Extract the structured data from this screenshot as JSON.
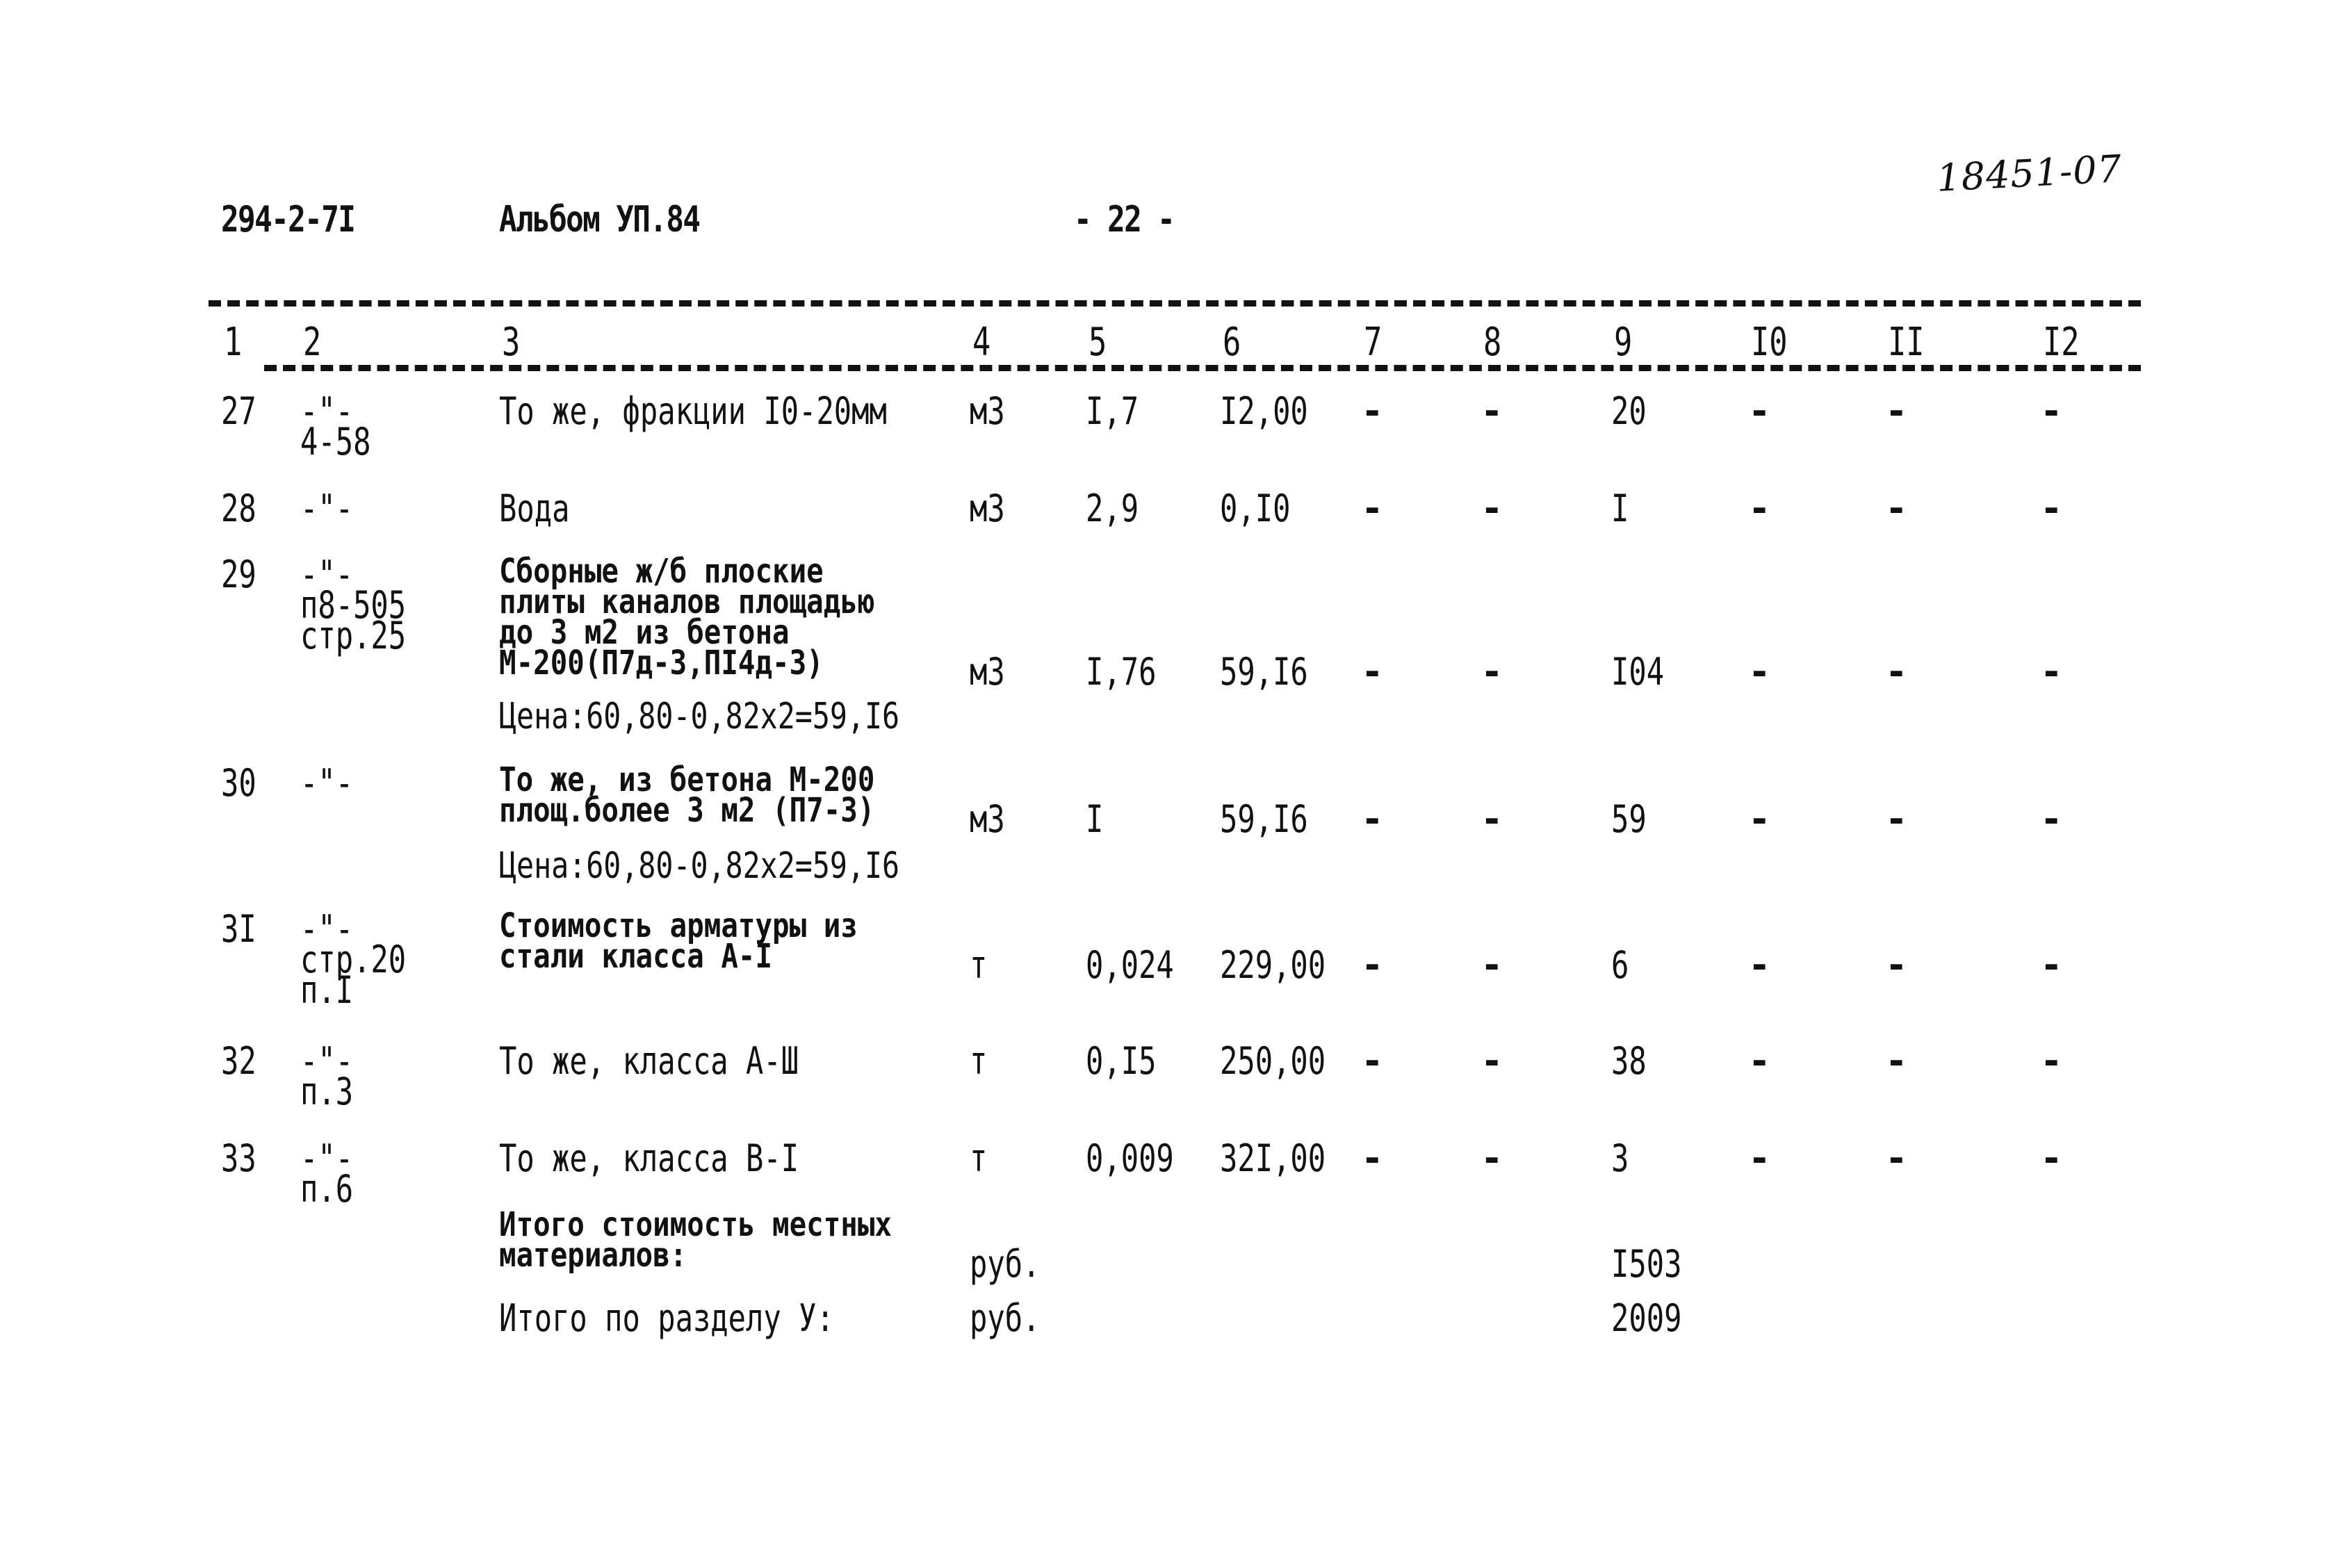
{
  "header": {
    "doc_code": "294-2-7I",
    "album": "Альбом УП.84",
    "page_number": "- 22 -",
    "handwritten_number": "18451-07"
  },
  "columns": [
    "1",
    "2",
    "3",
    "4",
    "5",
    "6",
    "7",
    "8",
    "9",
    "I0",
    "II",
    "I2"
  ],
  "rows": [
    {
      "num": "27",
      "ref": [
        "-\"-",
        "4-58"
      ],
      "desc": [
        "То же, фракции I0-20мм"
      ],
      "note": "",
      "unit": "м3",
      "qty": "I,7",
      "price": "I2,00",
      "c7": "-",
      "c8": "-",
      "c9": "20",
      "c10": "-",
      "c11": "-",
      "c12": "-"
    },
    {
      "num": "28",
      "ref": [
        "-\"-"
      ],
      "desc": [
        "Вода"
      ],
      "note": "",
      "unit": "м3",
      "qty": "2,9",
      "price": "0,I0",
      "c7": "-",
      "c8": "-",
      "c9": "I",
      "c10": "-",
      "c11": "-",
      "c12": "-"
    },
    {
      "num": "29",
      "ref": [
        "-\"-",
        "п8-505",
        "стр.25"
      ],
      "desc": [
        "Сборные ж/б плоские",
        "плиты каналов площадью",
        "до 3 м2 из бетона",
        "М-200(П7д-3,ПI4д-3)"
      ],
      "note": "Цена:60,80-0,82х2=59,I6",
      "unit": "м3",
      "qty": "I,76",
      "price": "59,I6",
      "c7": "-",
      "c8": "-",
      "c9": "I04",
      "c10": "-",
      "c11": "-",
      "c12": "-"
    },
    {
      "num": "30",
      "ref": [
        "-\"-"
      ],
      "desc": [
        "То же, из бетона М-200",
        "площ.более 3 м2 (П7-3)"
      ],
      "note": "Цена:60,80-0,82х2=59,I6",
      "unit": "м3",
      "qty": "I",
      "price": "59,I6",
      "c7": "-",
      "c8": "-",
      "c9": "59",
      "c10": "-",
      "c11": "-",
      "c12": "-"
    },
    {
      "num": "3I",
      "ref": [
        "-\"-",
        "стр.20",
        "п.I"
      ],
      "desc": [
        "Стоимость арматуры из",
        "стали класса А-I"
      ],
      "note": "",
      "unit": "т",
      "qty": "0,024",
      "price": "229,00",
      "c7": "-",
      "c8": "-",
      "c9": "6",
      "c10": "-",
      "c11": "-",
      "c12": "-"
    },
    {
      "num": "32",
      "ref": [
        "-\"-",
        "п.3"
      ],
      "desc": [
        "То же, класса А-Ш"
      ],
      "note": "",
      "unit": "т",
      "qty": "0,I5",
      "price": "250,00",
      "c7": "-",
      "c8": "-",
      "c9": "38",
      "c10": "-",
      "c11": "-",
      "c12": "-"
    },
    {
      "num": "33",
      "ref": [
        "-\"-",
        "п.6"
      ],
      "desc": [
        "То же, класса В-I"
      ],
      "note": "",
      "unit": "т",
      "qty": "0,009",
      "price": "32I,00",
      "c7": "-",
      "c8": "-",
      "c9": "3",
      "c10": "-",
      "c11": "-",
      "c12": "-"
    }
  ],
  "totals": [
    {
      "label": [
        "Итого стоимость местных",
        "материалов:"
      ],
      "unit": "руб.",
      "value": "I503"
    },
    {
      "label": [
        "Итого по разделу У:"
      ],
      "unit": "руб.",
      "value": "2009"
    }
  ]
}
